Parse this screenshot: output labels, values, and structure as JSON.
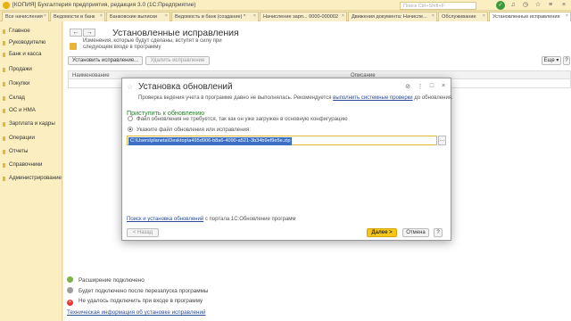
{
  "window": {
    "title": "[КОПИЯ] Бухгалтерия предприятия, редакция 3.0  (1С:Предприятие)",
    "search_placeholder": "Поиск Ctrl+Shift+F"
  },
  "tabs": [
    {
      "label": "Все начисления"
    },
    {
      "label": "Ведомости в банк"
    },
    {
      "label": "Банковские выписки"
    },
    {
      "label": "Ведомость в банк (создание) *"
    },
    {
      "label": "Начисление зарп... 0000-000002"
    },
    {
      "label": "Движения документа: Начисле..."
    },
    {
      "label": "Обслуживание"
    },
    {
      "label": "Установленные исправления"
    }
  ],
  "sidebar": {
    "items": [
      {
        "label": "Главное"
      },
      {
        "label": "Руководителю"
      },
      {
        "label": "Банк и касса"
      },
      {
        "label": "Продажи"
      },
      {
        "label": "Покупки"
      },
      {
        "label": "Склад"
      },
      {
        "label": "ОС и НМА"
      },
      {
        "label": "Зарплата и кадры"
      },
      {
        "label": "Операции"
      },
      {
        "label": "Отчеты"
      },
      {
        "label": "Справочники"
      },
      {
        "label": "Администрирование"
      }
    ]
  },
  "page": {
    "title": "Установленные исправления",
    "info": "Изменения, которые будут сделаны, вступят в силу при следующем входе в программу",
    "install_button": "Установить исправление...",
    "remove_button": "Удалить исправление",
    "more_button": "Еще",
    "help_button": "?",
    "columns": [
      "Наименование",
      "Описание"
    ],
    "legend": [
      {
        "text": "Расширение подключено",
        "color": "#7cb342"
      },
      {
        "text": "Будет подключено после перезапуска программы",
        "color": "#9e9e9e"
      },
      {
        "text": "Не удалось подключить при входе в программу",
        "color": "#e53935"
      }
    ],
    "tech_link": "Техническая информация об установке исправлений"
  },
  "dialog": {
    "title": "Установка обновлений",
    "warning_prefix": "Проверка ведения учета в программе давно не выполнялась. Рекомендуется ",
    "warning_link": "выполнить системные проверки",
    "warning_suffix": " до обновления.",
    "section": "Приступить к обновлению",
    "option1": "Файл обновления не требуется, так как он уже загружен в основную конфигурацию",
    "option2": "Укажите файл обновления или исправления:",
    "file_path": "C:\\Users\\planeta\\Desktop\\a495d906-b8a6-4090-a521-3b34b9ef9e5e.zip",
    "bottom_link": "Поиск и установка обновлений",
    "bottom_suffix": " с портала 1С:Обновление программ",
    "prev_button": "< Назад",
    "next_button": "Далее >",
    "cancel_button": "Отмена",
    "help_button": "?"
  }
}
